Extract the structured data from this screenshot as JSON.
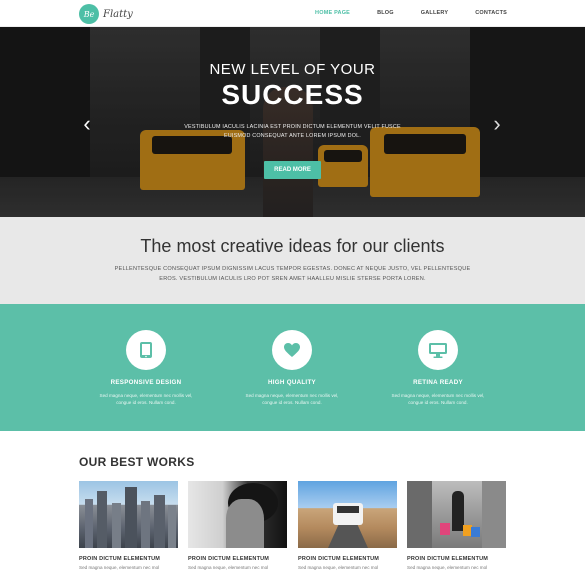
{
  "logo": {
    "badge": "Be",
    "name": "Flatty"
  },
  "nav": [
    "HOME PAGE",
    "BLOG",
    "GALLERY",
    "CONTACTS"
  ],
  "hero": {
    "line1": "NEW LEVEL OF YOUR",
    "line2": "SUCCESS",
    "desc": "VESTIBULUM IACULIS LACINIA EST PROIN DICTUM ELEMENTUM VELIT FUSCE EUISMOD CONSEQUAT ANTE LOREM IPSUM DOL.",
    "button": "READ MORE",
    "prev_icon": "‹",
    "next_icon": "›"
  },
  "intro": {
    "title": "The most creative ideas for our clients",
    "text": "PELLENTESQUE CONSEQUAT IPSUM DIGNISSIM LACUS TEMPOR EGESTAS. DONEC AT NEQUE JUSTO, VEL PELLENTESQUE EROS. VESTIBULUM IACULIS LRO POT SREN AMET HAALLEU MISLIE STERSE PORTA LOREN."
  },
  "features": [
    {
      "icon": "tablet-icon",
      "title": "RESPONSIVE DESIGN",
      "desc": "Sed magna neque, elementum nec mollis vel, congue id eros. Nullam cond."
    },
    {
      "icon": "heart-icon",
      "title": "HIGH QUALITY",
      "desc": "Sed magna neque, elementum nec mollis vel, congue id eros. Nullam cond."
    },
    {
      "icon": "monitor-icon",
      "title": "RETINA READY",
      "desc": "Sed magna neque, elementum nec mollis vel, congue id eros. Nullam cond."
    }
  ],
  "works": {
    "title": "OUR BEST WORKS",
    "items": [
      {
        "title": "PROIN DICTUM ELEMENTUM",
        "desc": "Sed magna neque, elementum nec mol"
      },
      {
        "title": "PROIN DICTUM ELEMENTUM",
        "desc": "Sed magna neque, elementum nec mol"
      },
      {
        "title": "PROIN DICTUM ELEMENTUM",
        "desc": "Sed magna neque, elementum nec mol"
      },
      {
        "title": "PROIN DICTUM ELEMENTUM",
        "desc": "Sed magna neque, elementum nec mol"
      }
    ]
  },
  "colors": {
    "accent": "#4dbfa6",
    "features_bg": "#5cbfa8",
    "intro_bg": "#e8e8e8"
  }
}
